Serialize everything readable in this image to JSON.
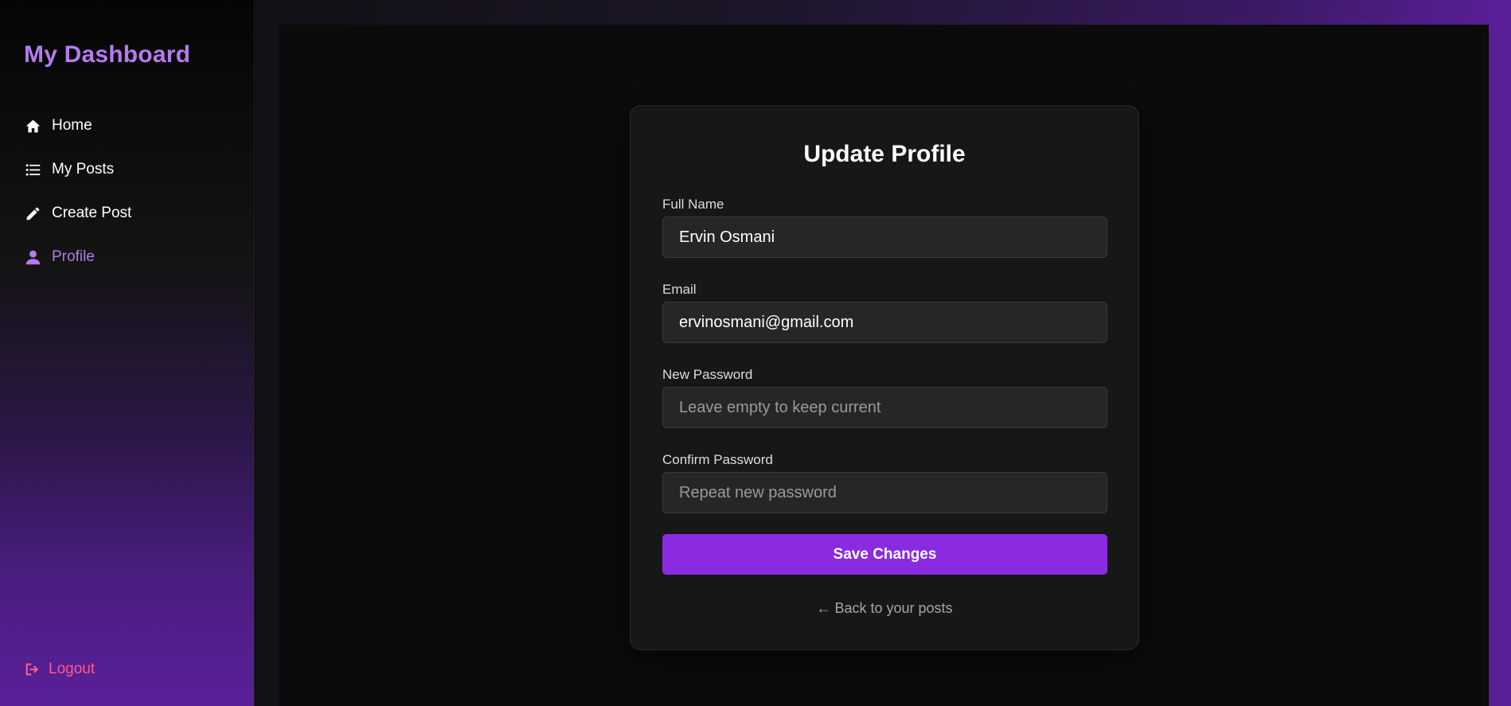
{
  "sidebar": {
    "brand": "My Dashboard",
    "items": [
      {
        "label": "Home",
        "icon": "home-icon"
      },
      {
        "label": "My Posts",
        "icon": "list-icon"
      },
      {
        "label": "Create Post",
        "icon": "pencil-icon"
      },
      {
        "label": "Profile",
        "icon": "user-icon",
        "active": true
      }
    ],
    "logout": "Logout"
  },
  "card": {
    "title": "Update Profile",
    "fields": [
      {
        "label": "Full Name",
        "value": "Ervin Osmani",
        "placeholder": ""
      },
      {
        "label": "Email",
        "value": "ervinosmani@gmail.com",
        "placeholder": ""
      },
      {
        "label": "New Password",
        "value": "",
        "placeholder": "Leave empty to keep current"
      },
      {
        "label": "Confirm Password",
        "value": "",
        "placeholder": "Repeat new password"
      }
    ],
    "save_label": "Save Changes",
    "back_link": "← Back to your posts"
  },
  "colors": {
    "accent": "#8a2be2",
    "brand": "#b57bf0",
    "logout": "#ff5c8a",
    "card_bg": "#171717",
    "page_bg": "#0b0b0b"
  }
}
